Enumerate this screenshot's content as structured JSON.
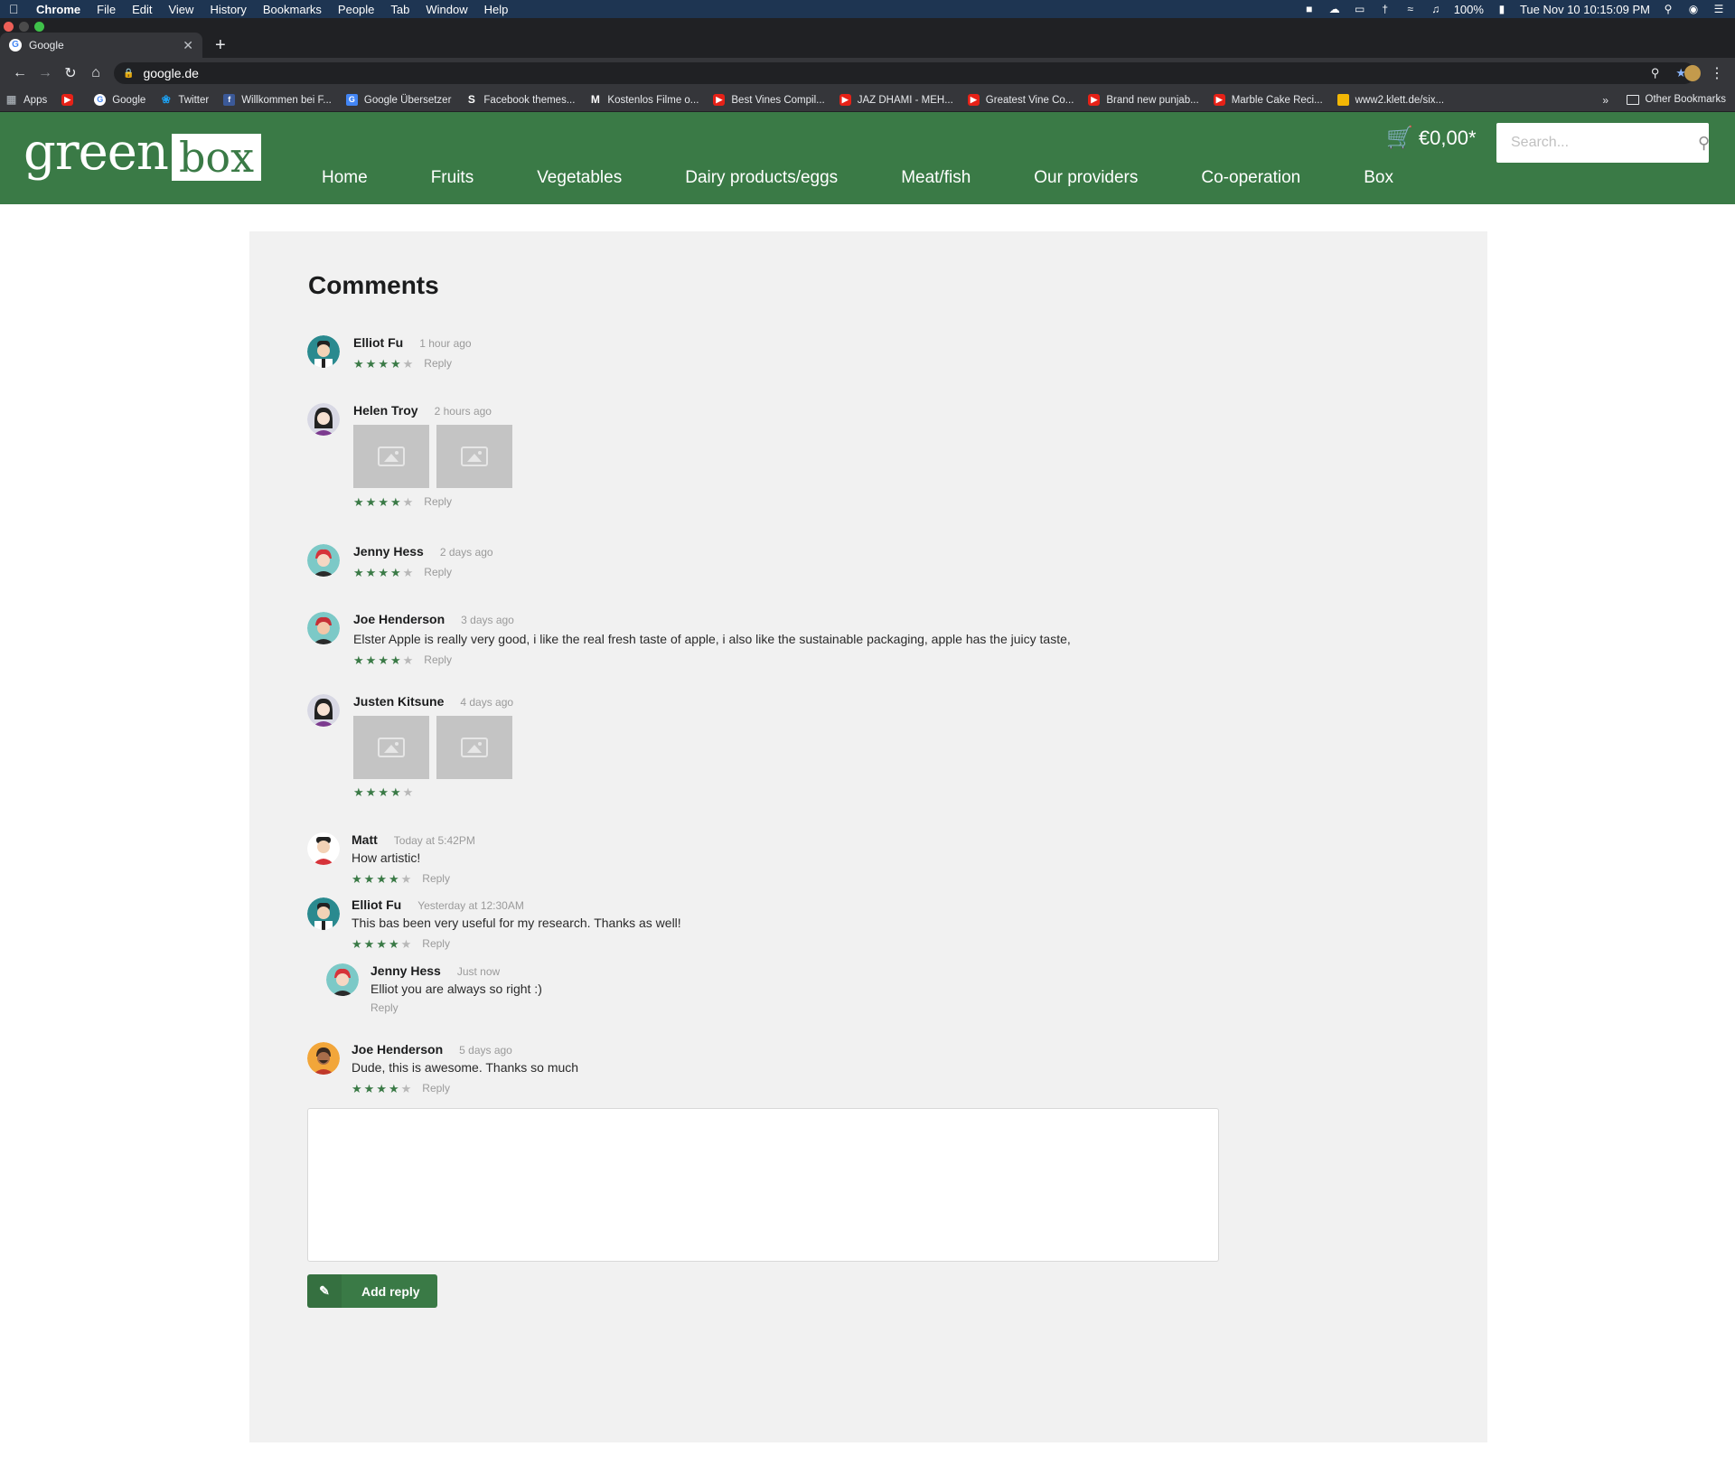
{
  "menubar": {
    "app": "Chrome",
    "items": [
      "File",
      "Edit",
      "View",
      "History",
      "Bookmarks",
      "People",
      "Tab",
      "Window",
      "Help"
    ],
    "battery": "100%",
    "clock": "Tue Nov 10  10:15:09 PM"
  },
  "browser": {
    "tab_title": "Google",
    "url": "google.de",
    "bookmarks": [
      "Apps",
      "Google",
      "Twitter",
      "Willkommen bei F...",
      "Google Übersetzer",
      "Facebook themes...",
      "Kostenlos Filme o...",
      "Best Vines Compil...",
      "JAZ DHAMI - MEH...",
      "Greatest Vine Co...",
      "Brand new punjab...",
      "Marble Cake Reci...",
      "www2.klett.de/six..."
    ],
    "more": "»",
    "other_bookmarks": "Other Bookmarks"
  },
  "site": {
    "logo_green": "green",
    "logo_box": "box",
    "nav": [
      "Home",
      "Fruits",
      "Vegetables",
      "Dairy products/eggs",
      "Meat/fish",
      "Our providers",
      "Co-operation",
      "Box"
    ],
    "cart_total": "€0,00*",
    "search_placeholder": "Search..."
  },
  "comments": {
    "heading": "Comments",
    "reply_label": "Reply",
    "list": [
      {
        "author": "Elliot Fu",
        "date": "1 hour ago",
        "text": "",
        "images": 0,
        "rating": 4,
        "reply": true
      },
      {
        "author": "Helen Troy",
        "date": "2 hours ago",
        "text": "",
        "images": 2,
        "rating": 4,
        "reply": true
      },
      {
        "author": "Jenny Hess",
        "date": "2 days ago",
        "text": "",
        "images": 0,
        "rating": 4,
        "reply": true
      },
      {
        "author": "Joe Henderson",
        "date": "3 days ago",
        "text": "Elster Apple is really very good, i like the real fresh taste of apple, i also like the sustainable packaging, apple has the juicy taste,",
        "images": 0,
        "rating": 4,
        "reply": true
      },
      {
        "author": "Justen Kitsune",
        "date": "4 days ago",
        "text": "",
        "images": 2,
        "rating": 4,
        "reply": false
      },
      {
        "author": "Matt",
        "date": "Today at 5:42PM",
        "text": "How artistic!",
        "images": 0,
        "rating": 4,
        "reply": true
      },
      {
        "author": "Elliot Fu",
        "date": "Yesterday at 12:30AM",
        "text": "This bas been very useful for my research. Thanks as well!",
        "images": 0,
        "rating": 4,
        "reply": true
      },
      {
        "author": "Jenny Hess",
        "date": "Just now",
        "text": "Elliot you are always so right :)",
        "images": 0,
        "rating": 0,
        "reply": true,
        "nested": true
      },
      {
        "author": "Joe Henderson",
        "date": "5 days ago",
        "text": "Dude, this is awesome. Thanks so much",
        "images": 0,
        "rating": 4,
        "reply": true
      }
    ],
    "add_reply_label": "Add reply"
  },
  "colors": {
    "brand_green": "#3a7a46",
    "panel": "#f1f1f1"
  }
}
